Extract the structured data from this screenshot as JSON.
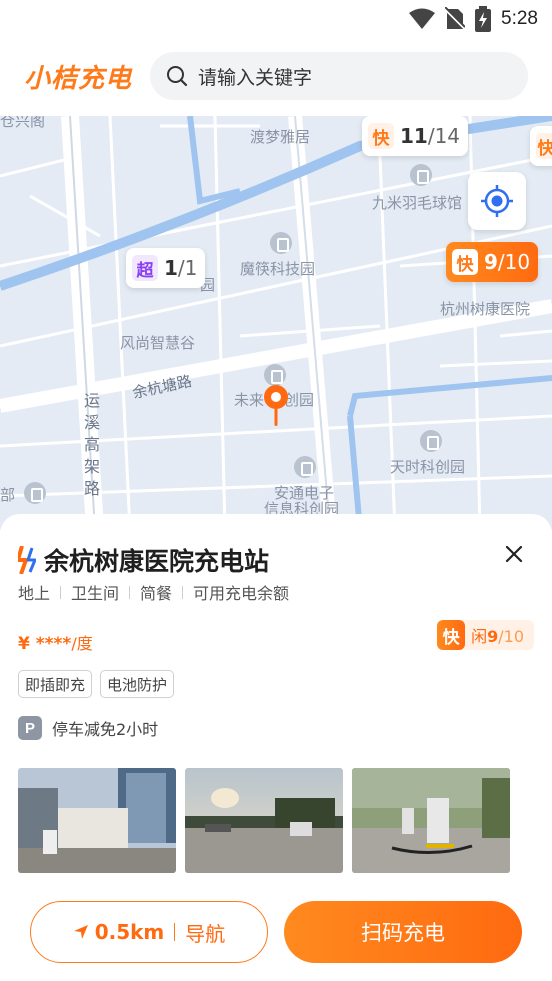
{
  "status_bar": {
    "time": "5:28"
  },
  "header": {
    "logo_text": "小桔充电",
    "search_placeholder": "请输入关键字"
  },
  "map": {
    "labels": {
      "dumeng": "渡梦雅居",
      "jiumi": "九米羽毛球馆",
      "moshu": "魔筷科技园",
      "yuan": "园",
      "fengshang": "风尚智慧谷",
      "yuhangtang": "余杭塘路",
      "weilai": "未来",
      "weilai2": "创园",
      "shukang": "杭州树康医院",
      "tianshi": "天时科创园",
      "andian1": "安通电子",
      "andian2": "信息科创园",
      "yunxi": "运溪高架路",
      "bu": "部",
      "cangxing": "仓兴阁"
    },
    "markers": [
      {
        "type_label": "快",
        "available": "11",
        "total": "/14",
        "style": "white"
      },
      {
        "type_label": "超",
        "available": "1",
        "total": "/1",
        "style": "white"
      },
      {
        "type_label": "快",
        "available": "9",
        "total": "/10",
        "style": "orange"
      },
      {
        "type_label": "快",
        "available": "",
        "total": "",
        "style": "white"
      }
    ]
  },
  "station": {
    "name": "余杭树康医院充电站",
    "facilities": [
      "地上",
      "卫生间",
      "简餐",
      "可用充电余额"
    ],
    "price_currency": "¥",
    "price_masked": "****",
    "price_unit": "/度",
    "fast_label": "快",
    "fast_idle_prefix": "闲",
    "fast_idle": "9",
    "fast_total": "/10",
    "tags": [
      "即插即充",
      "电池防护"
    ],
    "parking_icon_text": "P",
    "parking_text": "停车减免2小时"
  },
  "actions": {
    "distance": "0.5km",
    "navigate_label": "导航",
    "scan_label": "扫码充电"
  },
  "colors": {
    "accent": "#ff7a1a",
    "map_bg": "#e4ebf4",
    "water": "#9fc4ef"
  }
}
